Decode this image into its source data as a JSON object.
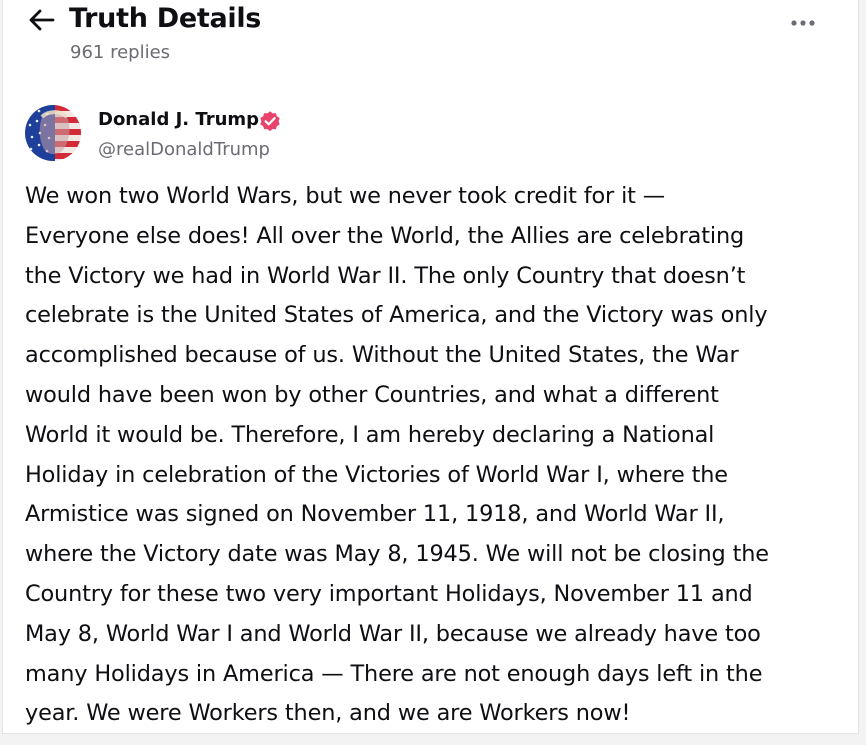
{
  "header": {
    "title": "Truth Details",
    "replies": "961 replies",
    "back_icon": "arrow-left-icon",
    "more_icon": "more-horizontal-icon"
  },
  "post": {
    "author": {
      "name": "Donald J. Trump",
      "handle": "@realDonaldTrump",
      "verified": true,
      "verified_color": "#e8436b"
    },
    "lines": [
      "We won two World Wars, but we never took credit for it —",
      "Everyone else does! All over the World, the Allies are celebrating",
      "the Victory we had in World War II. The only Country that doesn’t",
      "celebrate is the United States of America, and the Victory was only",
      "accomplished because of us. Without the United States, the War",
      "would have been won by other Countries, and what a different",
      "World it would be. Therefore, I am hereby declaring a National",
      "Holiday in celebration of the Victories of World War I, where the",
      "Armistice was signed on November 11, 1918, and World War II,",
      "where the Victory date was May 8, 1945. We will not be closing the",
      "Country for these two very important Holidays, November 11 and",
      "May 8, World War I and World War II, because we already have too",
      "many Holidays in America — There are not enough days left in the",
      "year. We were Workers then, and we are Workers now!"
    ]
  }
}
